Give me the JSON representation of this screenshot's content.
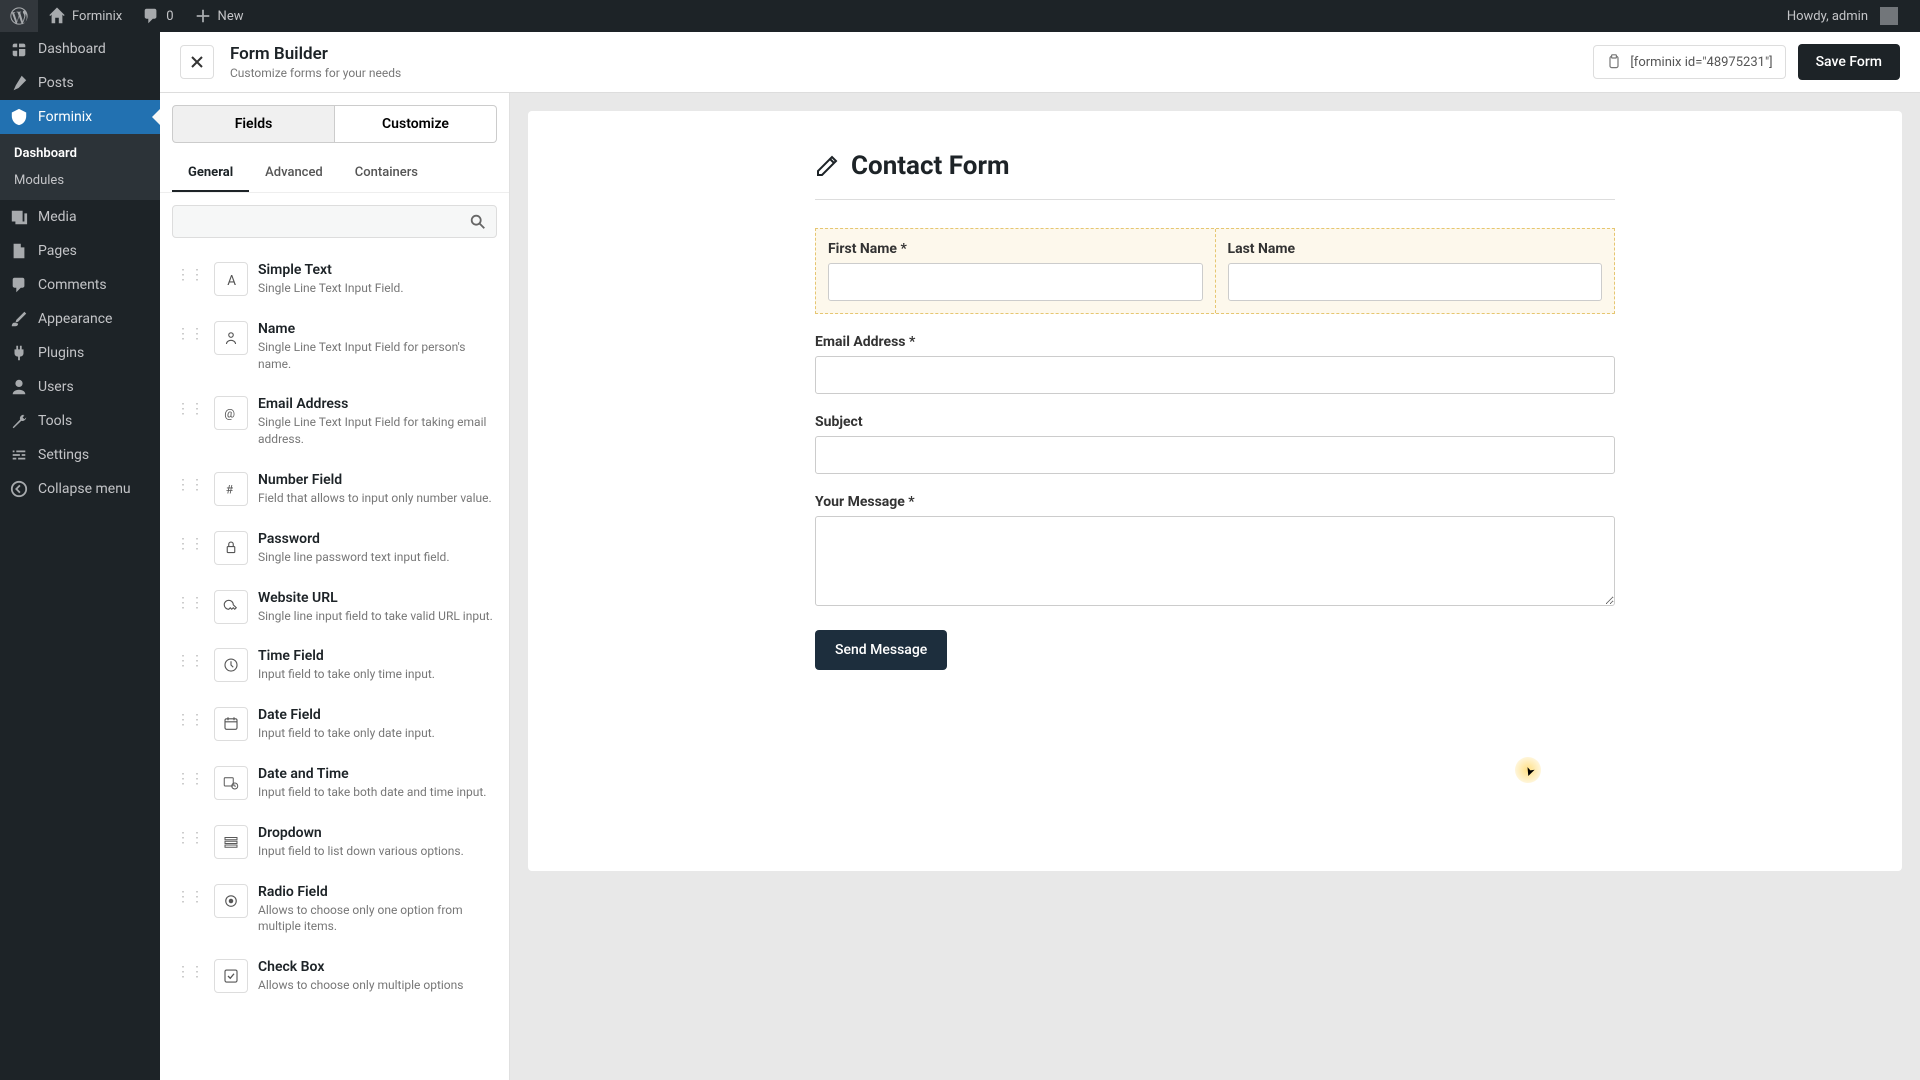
{
  "adminbar": {
    "site_name": "Forminix",
    "comments_count": "0",
    "new_label": "New",
    "howdy": "Howdy, admin"
  },
  "wp_menu": {
    "dashboard": "Dashboard",
    "posts": "Posts",
    "forminix": "Forminix",
    "forminix_sub": {
      "dashboard": "Dashboard",
      "modules": "Modules"
    },
    "media": "Media",
    "pages": "Pages",
    "comments": "Comments",
    "appearance": "Appearance",
    "plugins": "Plugins",
    "users": "Users",
    "tools": "Tools",
    "settings": "Settings",
    "collapse": "Collapse menu"
  },
  "header": {
    "title": "Form Builder",
    "subtitle": "Customize forms for your needs",
    "shortcode": "[forminix id=\"48975231\"]",
    "save": "Save Form"
  },
  "panel": {
    "tab_fields": "Fields",
    "tab_customize": "Customize",
    "subtab_general": "General",
    "subtab_advanced": "Advanced",
    "subtab_containers": "Containers",
    "search_placeholder": ""
  },
  "fields": [
    {
      "title": "Simple Text",
      "desc": "Single Line Text Input Field."
    },
    {
      "title": "Name",
      "desc": "Single Line Text Input Field for person's name."
    },
    {
      "title": "Email Address",
      "desc": "Single Line Text Input Field for taking email address."
    },
    {
      "title": "Number Field",
      "desc": "Field that allows to input only number value."
    },
    {
      "title": "Password",
      "desc": "Single line password text input field."
    },
    {
      "title": "Website URL",
      "desc": "Single line input field to take valid URL input."
    },
    {
      "title": "Time Field",
      "desc": "Input field to take only time input."
    },
    {
      "title": "Date Field",
      "desc": "Input field to take only date input."
    },
    {
      "title": "Date and Time",
      "desc": "Input field to take both date and time input."
    },
    {
      "title": "Dropdown",
      "desc": "Input field to list down various options."
    },
    {
      "title": "Radio Field",
      "desc": "Allows to choose only one option from multiple items."
    },
    {
      "title": "Check Box",
      "desc": "Allows to choose only multiple options"
    }
  ],
  "form": {
    "title": "Contact Form",
    "first_name": "First Name *",
    "last_name": "Last Name",
    "email": "Email Address *",
    "subject": "Subject",
    "message": "Your Message *",
    "submit": "Send Message"
  }
}
